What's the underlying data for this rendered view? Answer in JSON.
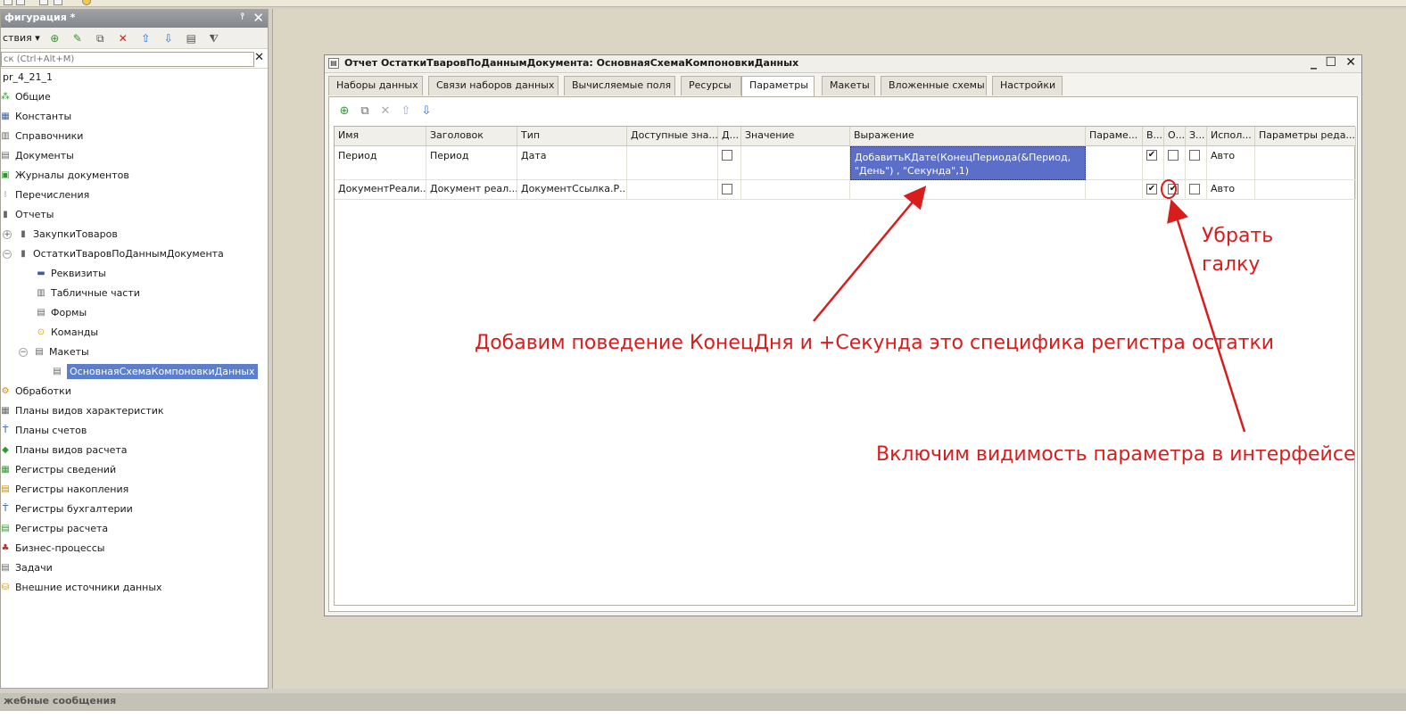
{
  "left_panel": {
    "title": "фигурация *",
    "actions_label": "ствия",
    "search_placeholder": "ск (Ctrl+Alt+M)",
    "tree": [
      {
        "label": "pr_4_21_1",
        "icon": "none"
      },
      {
        "label": "Общие",
        "icon": "common-icon"
      },
      {
        "label": "Константы",
        "icon": "constants-icon"
      },
      {
        "label": "Справочники",
        "icon": "catalogs-icon"
      },
      {
        "label": "Документы",
        "icon": "documents-icon"
      },
      {
        "label": "Журналы документов",
        "icon": "journals-icon"
      },
      {
        "label": "Перечисления",
        "icon": "enums-icon"
      },
      {
        "label": "Отчеты",
        "icon": "reports-icon"
      },
      {
        "label": "ЗакупкиТоваров",
        "icon": "report-icon"
      },
      {
        "label": "ОстаткиТваровПоДаннымДокумента",
        "icon": "report-icon"
      },
      {
        "label": "Реквизиты",
        "icon": "attributes-icon"
      },
      {
        "label": "Табличные части",
        "icon": "tabular-icon"
      },
      {
        "label": "Формы",
        "icon": "forms-icon"
      },
      {
        "label": "Команды",
        "icon": "commands-icon"
      },
      {
        "label": "Макеты",
        "icon": "templates-icon"
      },
      {
        "label": "ОсновнаяСхемаКомпоновкиДанных",
        "icon": "template-icon"
      },
      {
        "label": "Обработки",
        "icon": "dataprocessors-icon"
      },
      {
        "label": "Планы видов характеристик",
        "icon": "chart-of-characteristics-icon"
      },
      {
        "label": "Планы счетов",
        "icon": "chart-of-accounts-icon"
      },
      {
        "label": "Планы видов расчета",
        "icon": "calculation-types-icon"
      },
      {
        "label": "Регистры сведений",
        "icon": "info-registers-icon"
      },
      {
        "label": "Регистры накопления",
        "icon": "accum-registers-icon"
      },
      {
        "label": "Регистры бухгалтерии",
        "icon": "accounting-registers-icon"
      },
      {
        "label": "Регистры расчета",
        "icon": "calc-registers-icon"
      },
      {
        "label": "Бизнес-процессы",
        "icon": "business-processes-icon"
      },
      {
        "label": "Задачи",
        "icon": "tasks-icon"
      },
      {
        "label": "Внешние источники данных",
        "icon": "external-sources-icon"
      }
    ]
  },
  "window": {
    "title": "Отчет ОстаткиТваровПоДаннымДокумента: ОсновнаяСхемаКомпоновкиДанных",
    "tabs": [
      "Наборы данных",
      "Связи наборов данных",
      "Вычисляемые поля",
      "Ресурсы",
      "Параметры",
      "Макеты",
      "Вложенные схемы",
      "Настройки"
    ],
    "active_tab": "Параметры"
  },
  "grid": {
    "headers": [
      "Имя",
      "Заголовок",
      "Тип",
      "Доступные зна...",
      "Д...",
      "Значение",
      "Выражение",
      "Параме...",
      "В...",
      "О...",
      "З...",
      "Испол...",
      "Параметры реда..."
    ],
    "rows": [
      {
        "name": "Период",
        "title": "Период",
        "type": "Дата",
        "available": "",
        "value": "",
        "expression": "ДобавитьКДате(КонецПериода(&Период, \"День\") , \"Секунда\",1)",
        "param": "",
        "d": false,
        "v": true,
        "o": false,
        "z": false,
        "use": "Авто",
        "edit": ""
      },
      {
        "name": "ДокументРеали...",
        "title": "Документ реал...",
        "type": "ДокументСсылка.Р...",
        "available": "",
        "value": "",
        "expression": "",
        "param": "",
        "d": false,
        "v": true,
        "o": true,
        "z": false,
        "use": "Авто",
        "edit": ""
      }
    ]
  },
  "annotations": {
    "remove_check_line1": "Убрать",
    "remove_check_line2": "галку",
    "add_behavior": "Добавим поведение КонецДня и +Секунда это специфика регистра остатки",
    "enable_visibility": "Включим видимость параметра в интерфейсе",
    "color": "#d81d1d"
  },
  "status": {
    "title": "жебные сообщения"
  }
}
